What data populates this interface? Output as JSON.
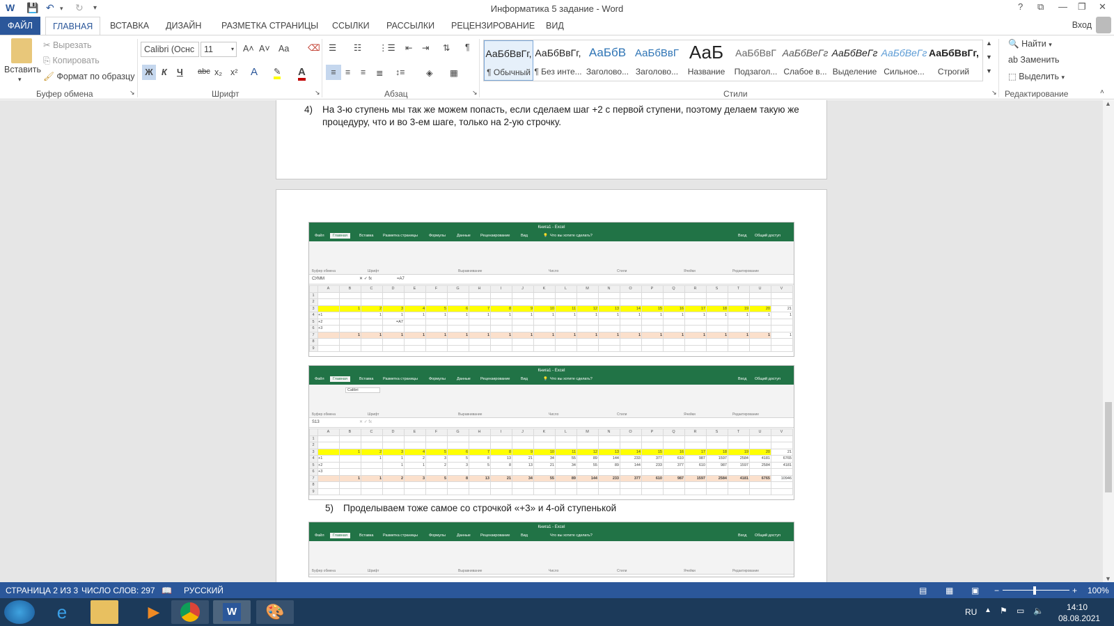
{
  "titlebar": {
    "doc_title": "Информатика 5 задание - Word",
    "help": "?"
  },
  "tabs": {
    "file": "ФАЙЛ",
    "home": "ГЛАВНАЯ",
    "insert": "ВСТАВКА",
    "design": "ДИЗАЙН",
    "layout": "РАЗМЕТКА СТРАНИЦЫ",
    "references": "ССЫЛКИ",
    "mailings": "РАССЫЛКИ",
    "review": "РЕЦЕНЗИРОВАНИЕ",
    "view": "ВИД",
    "signin": "Вход"
  },
  "ribbon": {
    "clipboard": {
      "paste": "Вставить",
      "cut": "Вырезать",
      "copy": "Копировать",
      "format_painter": "Формат по образцу",
      "label": "Буфер обмена"
    },
    "font": {
      "name": "Calibri (Оснс",
      "size": "11",
      "label": "Шрифт",
      "case": "Aa",
      "bold": "Ж",
      "italic": "К",
      "underline": "Ч",
      "strike": "abc",
      "sub": "x₂",
      "sup": "x²"
    },
    "paragraph": {
      "label": "Абзац"
    },
    "styles": {
      "label": "Стили",
      "items": [
        {
          "sample": "АаБбВвГг,",
          "name": "¶ Обычный"
        },
        {
          "sample": "АаБбВвГг,",
          "name": "¶ Без инте..."
        },
        {
          "sample": "АаБбВ",
          "name": "Заголово..."
        },
        {
          "sample": "АаБбВвГ",
          "name": "Заголово..."
        },
        {
          "sample": "АаБ",
          "name": "Название"
        },
        {
          "sample": "АаБбВвГ",
          "name": "Подзагол..."
        },
        {
          "sample": "АаБбВеГг",
          "name": "Слабое в..."
        },
        {
          "sample": "АаБбВеГг",
          "name": "Выделение"
        },
        {
          "sample": "АаБбВеГг",
          "name": "Сильное..."
        },
        {
          "sample": "АаБбВвГг,",
          "name": "Строгий"
        }
      ]
    },
    "editing": {
      "find": "Найти",
      "replace": "Заменить",
      "select": "Выделить",
      "label": "Редактирование"
    }
  },
  "document": {
    "item4_num": "4)",
    "item4_line1": "На 3-ю ступень мы так же можем попасть, если сделаем шаг +2 с первой ступени, поэтому делаем такую же",
    "item4_line2": "процедуру, что и во 3-ем шаге, только на 2-ую строчку.",
    "item5_num": "5)",
    "item5_text": "Проделываем тоже самое со строчкой «+3» и 4-ой ступенькой"
  },
  "excel": {
    "title": "Книга1 - Excel",
    "tabs": [
      "Файл",
      "Главная",
      "Вставка",
      "Разметка страницы",
      "Формулы",
      "Данные",
      "Рецензирование",
      "Вид"
    ],
    "search": "Что вы хотите сделать?",
    "share": "Общий доступ",
    "signin": "Вход",
    "groups": [
      "Буфер обмена",
      "Шрифт",
      "Выравнивание",
      "Число",
      "Стили",
      "Ячейки",
      "Редактирование"
    ],
    "columns": [
      "A",
      "B",
      "C",
      "D",
      "E",
      "F",
      "G",
      "H",
      "I",
      "J",
      "K",
      "L",
      "M",
      "N",
      "O",
      "P",
      "Q",
      "R",
      "S",
      "T",
      "U",
      "V"
    ],
    "shot1": {
      "namebox": "СУММ",
      "formula": "=A7",
      "rows": [
        [
          "1",
          ""
        ],
        [
          "2",
          ""
        ],
        [
          "3",
          "",
          "1",
          "2",
          "3",
          "4",
          "5",
          "6",
          "7",
          "8",
          "9",
          "10",
          "11",
          "12",
          "13",
          "14",
          "15",
          "16",
          "17",
          "18",
          "19",
          "20",
          "21"
        ],
        [
          "4",
          "+1",
          "",
          "1",
          "1",
          "1",
          "1",
          "1",
          "1",
          "1",
          "1",
          "1",
          "1",
          "1",
          "1",
          "1",
          "1",
          "1",
          "1",
          "1",
          "1",
          "1",
          "1"
        ],
        [
          "5",
          "+2",
          "",
          "",
          "=A7"
        ],
        [
          "6",
          "+3"
        ],
        [
          "7",
          "",
          "1",
          "1",
          "1",
          "1",
          "1",
          "1",
          "1",
          "1",
          "1",
          "1",
          "1",
          "1",
          "1",
          "1",
          "1",
          "1",
          "1",
          "1",
          "1",
          "1",
          "1"
        ],
        [
          "8",
          ""
        ],
        [
          "9",
          ""
        ]
      ]
    },
    "shot2": {
      "namebox": "S13",
      "font": "Calibri",
      "formula": "",
      "rows": [
        [
          "1",
          ""
        ],
        [
          "2",
          ""
        ],
        [
          "3",
          "",
          "1",
          "2",
          "3",
          "4",
          "5",
          "6",
          "7",
          "8",
          "9",
          "10",
          "11",
          "12",
          "13",
          "14",
          "15",
          "16",
          "17",
          "18",
          "19",
          "20",
          "21"
        ],
        [
          "4",
          "+1",
          "",
          "1",
          "1",
          "2",
          "3",
          "5",
          "8",
          "13",
          "21",
          "34",
          "55",
          "89",
          "144",
          "233",
          "377",
          "610",
          "987",
          "1597",
          "2584",
          "4181",
          "6765"
        ],
        [
          "5",
          "+2",
          "",
          "",
          "1",
          "1",
          "2",
          "3",
          "5",
          "8",
          "13",
          "21",
          "34",
          "55",
          "89",
          "144",
          "233",
          "377",
          "610",
          "987",
          "1597",
          "2584",
          "4181"
        ],
        [
          "6",
          "+3"
        ],
        [
          "7",
          "",
          "1",
          "1",
          "2",
          "3",
          "5",
          "8",
          "13",
          "21",
          "34",
          "55",
          "89",
          "144",
          "233",
          "377",
          "610",
          "987",
          "1597",
          "2584",
          "4181",
          "6765",
          "10946"
        ],
        [
          "8",
          ""
        ],
        [
          "9",
          ""
        ]
      ]
    }
  },
  "status": {
    "page": "СТРАНИЦА 2 ИЗ 3",
    "words": "ЧИСЛО СЛОВ: 297",
    "lang": "РУССКИЙ",
    "zoom": "100%"
  },
  "taskbar": {
    "lang": "RU",
    "time": "14:10",
    "date": "08.08.2021"
  }
}
